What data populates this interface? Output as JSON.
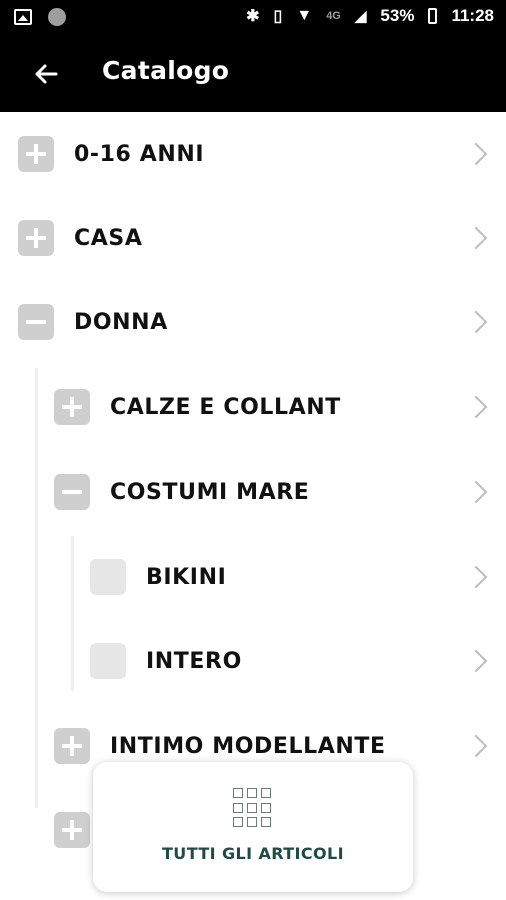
{
  "status_bar": {
    "battery": "53%",
    "time": "11:28",
    "network": "4G"
  },
  "app_bar": {
    "title": "Catalogo"
  },
  "categories": {
    "cat_0_16": "0-16 ANNI",
    "cat_casa": "CASA",
    "cat_donna": "DONNA",
    "sub_calze": "CALZE E COLLANT",
    "sub_costumi": "COSTUMI MARE",
    "leaf_bikini": "BIKINI",
    "leaf_intero": "INTERO",
    "sub_intimo": "INTIMO MODELLANTE"
  },
  "footer_card": {
    "label": "TUTTI GLI ARTICOLI"
  },
  "colors": {
    "bar": "#000000",
    "expander": "#cfcfcf",
    "card_text": "#1f4a45"
  }
}
